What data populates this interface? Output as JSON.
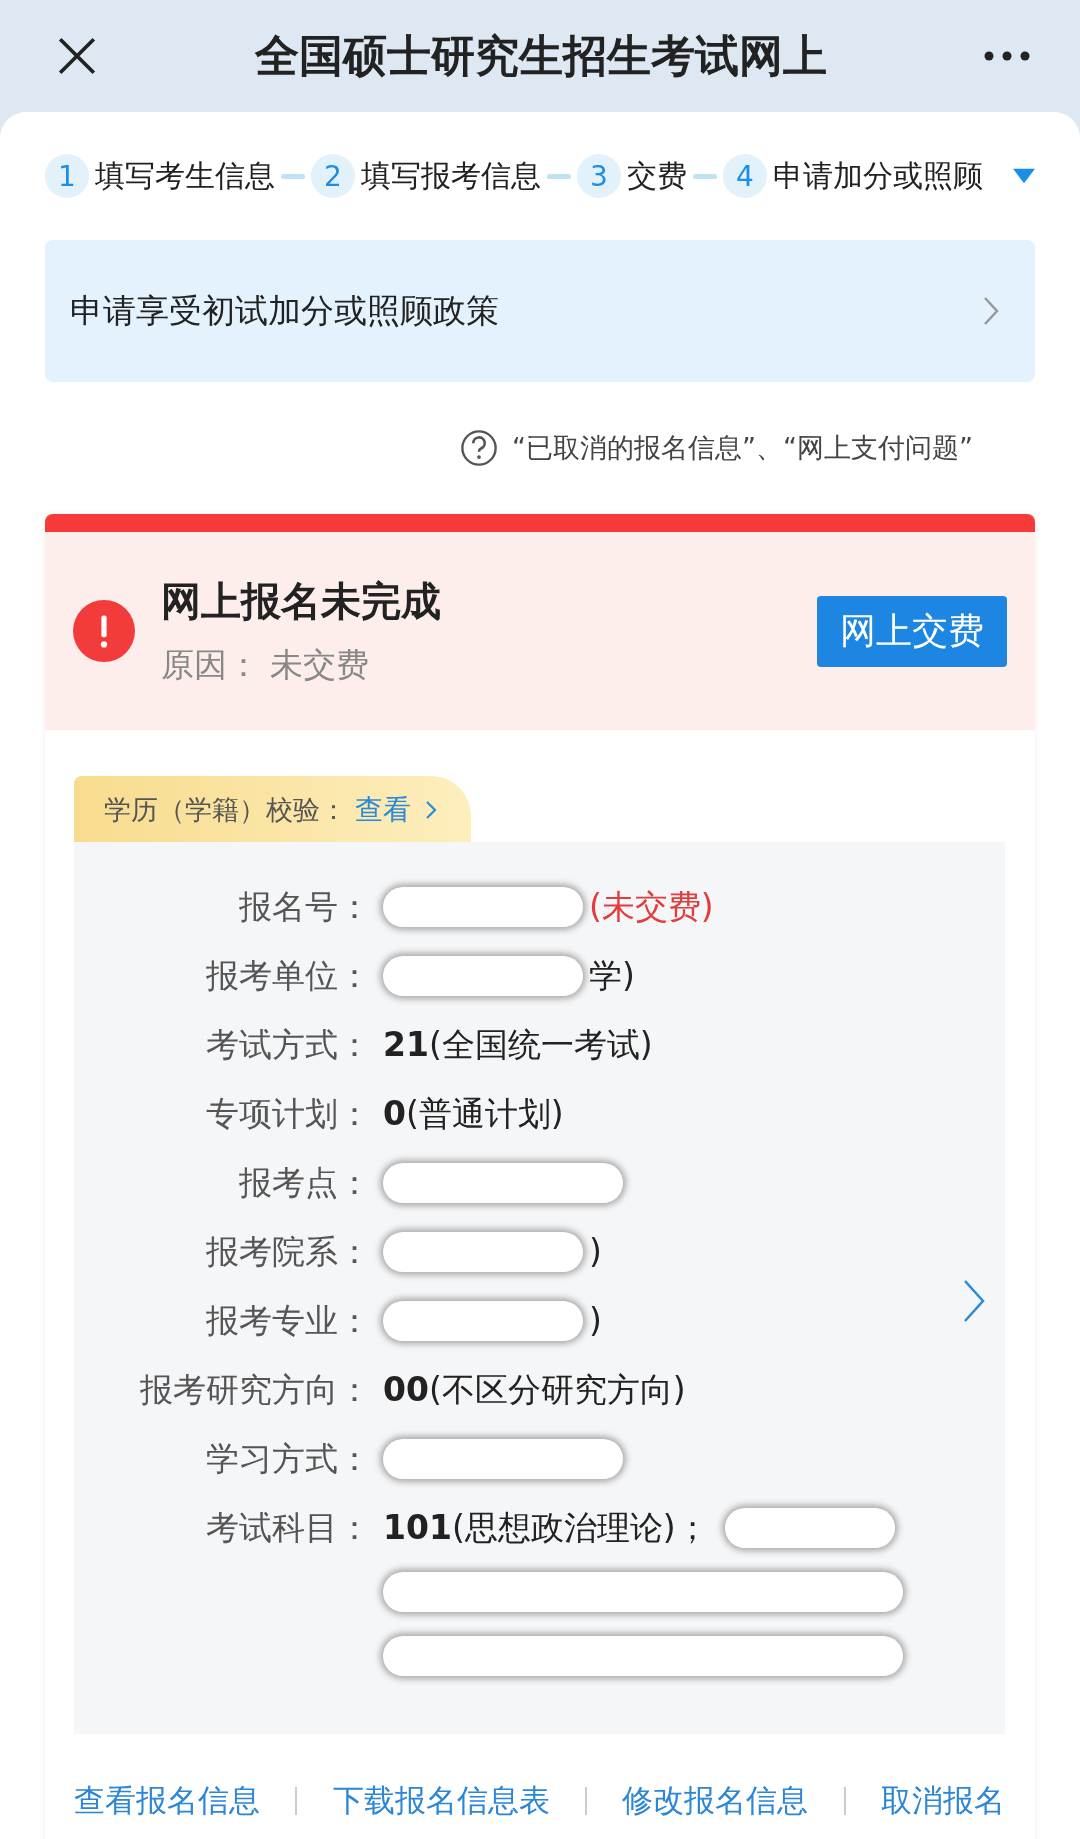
{
  "header": {
    "title": "全国硕士研究生招生考试网上"
  },
  "steps": [
    {
      "number": "1",
      "label": "填写考生信息"
    },
    {
      "number": "2",
      "label": "填写报考信息"
    },
    {
      "number": "3",
      "label": "交费"
    },
    {
      "number": "4",
      "label": "申请加分或照顾"
    }
  ],
  "policy_banner": {
    "label": "申请享受初试加分或照顾政策"
  },
  "help_link": {
    "label": "“已取消的报名信息”、“网上支付问题”"
  },
  "status": {
    "title": "网上报名未完成",
    "reason": "原因：  未交费",
    "button": "网上交费"
  },
  "verification": {
    "label": "学历（学籍）校验：",
    "link": "查看"
  },
  "fields": [
    {
      "label": "报名号：",
      "kind": "redacted",
      "suffix": "(未交费)",
      "alert": true
    },
    {
      "label": "报考单位：",
      "kind": "redacted",
      "suffix": "学)",
      "alert": false
    },
    {
      "label": "考试方式：",
      "kind": "text",
      "value": "**21**(全国统一考试)"
    },
    {
      "label": "专项计划：",
      "kind": "text",
      "value": "**0**(普通计划)"
    },
    {
      "label": "报考点：",
      "kind": "redacted"
    },
    {
      "label": "报考院系：",
      "kind": "redacted",
      "suffix": ")",
      "alert": false
    },
    {
      "label": "报考专业：",
      "kind": "redacted",
      "suffix": ")",
      "alert": false
    },
    {
      "label": "报考研究方向：",
      "kind": "text",
      "value": "**00**(不区分研究方向)"
    },
    {
      "label": "学习方式：",
      "kind": "redacted"
    },
    {
      "label": "考试科目：",
      "kind": "text_redacted",
      "value": "**101**(思想政治理论)；"
    }
  ],
  "actions": [
    "查看报名信息",
    "下载报名信息表",
    "修改报名信息",
    "取消报名"
  ]
}
